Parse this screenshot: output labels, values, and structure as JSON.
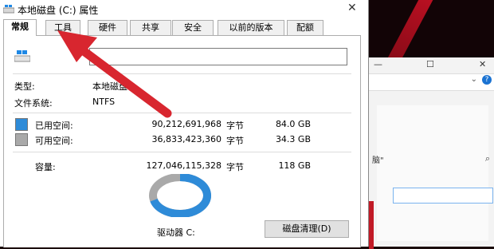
{
  "window": {
    "title": "本地磁盘 (C:) 属性",
    "close_glyph": "✕"
  },
  "tabs": [
    {
      "label": "常规",
      "active": true
    },
    {
      "label": "工具",
      "active": false
    },
    {
      "label": "硬件",
      "active": false
    },
    {
      "label": "共享",
      "active": false
    },
    {
      "label": "安全",
      "active": false
    },
    {
      "label": "以前的版本",
      "active": false
    },
    {
      "label": "配额",
      "active": false
    }
  ],
  "general": {
    "type_label": "类型:",
    "type_value": "本地磁盘",
    "fs_label": "文件系统:",
    "fs_value": "NTFS",
    "used": {
      "label": "已用空间:",
      "bytes": "90,212,691,968",
      "unit": "字节",
      "size": "84.0 GB",
      "color": "#2e8bd8"
    },
    "free": {
      "label": "可用空间:",
      "bytes": "36,833,423,360",
      "unit": "字节",
      "size": "34.3 GB",
      "color": "#a9a9a9"
    },
    "capacity": {
      "label": "容量:",
      "bytes": "127,046,115,328",
      "unit": "字节",
      "size": "118 GB"
    },
    "usage_fraction": 0.71,
    "drive_label": "驱动器 C:",
    "cleanup_button": "磁盘清理(D)"
  },
  "background_window": {
    "buttons": {
      "minimize": "—",
      "maximize": "☐",
      "close": "✕"
    },
    "help_icon": "?",
    "text_fragment": "脑\"",
    "text_fragment2": "⌕"
  },
  "colors": {
    "arrow": "#d8262f",
    "used": "#2e8bd8",
    "free": "#a9a9a9"
  }
}
